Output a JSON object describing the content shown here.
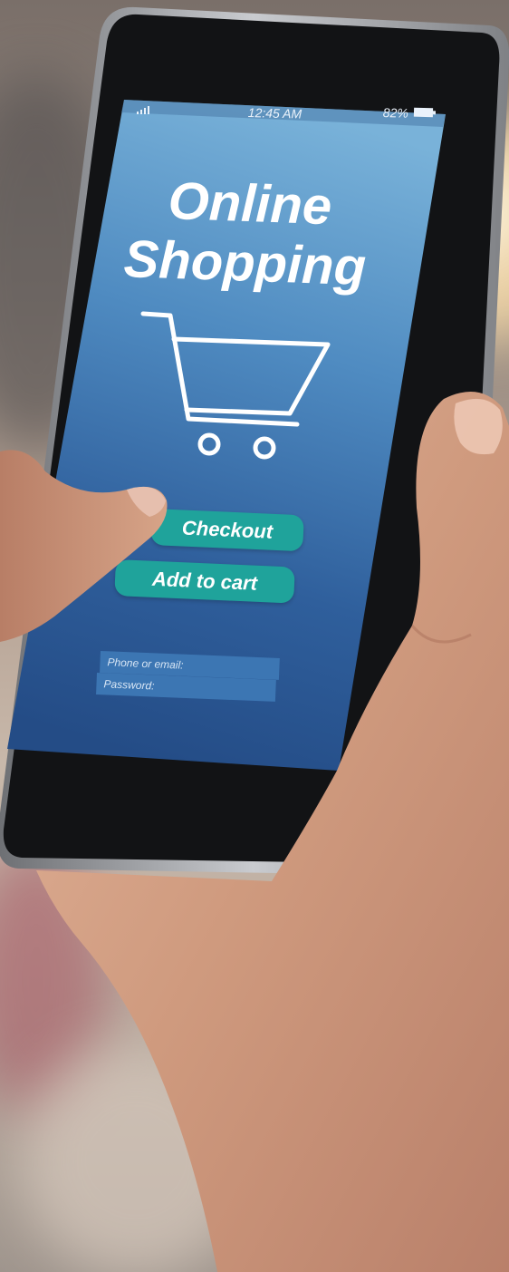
{
  "status_bar": {
    "time": "12:45 AM",
    "battery": "82%",
    "signal_icon": "signal-bars-icon",
    "battery_icon": "battery-icon"
  },
  "screen": {
    "title_line_1": "Online",
    "title_line_2": "Shopping",
    "cart_icon": "shopping-cart-icon",
    "checkout_label": "Checkout",
    "add_to_cart_label": "Add to cart",
    "phone_email_placeholder": "Phone or email:",
    "password_placeholder": "Password:"
  },
  "colors": {
    "screen_top": "#6fa7d2",
    "screen_bottom": "#234b86",
    "button": "#1fa39b",
    "field": "#3c76b3"
  }
}
